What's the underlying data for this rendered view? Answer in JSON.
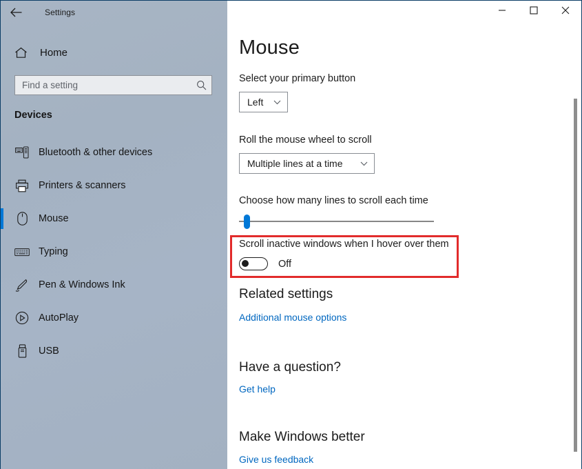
{
  "window": {
    "app_title": "Settings",
    "back_icon": "back-arrow-icon",
    "controls": {
      "minimize": "minimize-icon",
      "maximize": "maximize-icon",
      "close": "close-icon"
    }
  },
  "sidebar": {
    "home_label": "Home",
    "home_icon": "home-icon",
    "search": {
      "value": "",
      "placeholder": "Find a setting",
      "icon": "search-icon"
    },
    "category_heading": "Devices",
    "items": [
      {
        "label": "Bluetooth & other devices",
        "icon": "bluetooth-devices-icon",
        "selected": false
      },
      {
        "label": "Printers & scanners",
        "icon": "printer-icon",
        "selected": false
      },
      {
        "label": "Mouse",
        "icon": "mouse-icon",
        "selected": true
      },
      {
        "label": "Typing",
        "icon": "keyboard-icon",
        "selected": false
      },
      {
        "label": "Pen & Windows Ink",
        "icon": "pen-icon",
        "selected": false
      },
      {
        "label": "AutoPlay",
        "icon": "autoplay-icon",
        "selected": false
      },
      {
        "label": "USB",
        "icon": "usb-icon",
        "selected": false
      }
    ]
  },
  "main": {
    "page_title": "Mouse",
    "primary_button": {
      "label": "Select your primary button",
      "value": "Left",
      "chevron": "chevron-down-icon"
    },
    "scroll_wheel": {
      "label": "Roll the mouse wheel to scroll",
      "value": "Multiple lines at a time",
      "chevron": "chevron-down-icon"
    },
    "lines_slider": {
      "label": "Choose how many lines to scroll each time",
      "value": 3,
      "min": 1,
      "max": 100
    },
    "inactive_scroll": {
      "label": "Scroll inactive windows when I hover over them",
      "state": "Off",
      "checked": false,
      "highlighted": true
    },
    "related_settings": {
      "heading": "Related settings",
      "link": "Additional mouse options"
    },
    "question": {
      "heading": "Have a question?",
      "link": "Get help"
    },
    "feedback": {
      "heading": "Make Windows better",
      "link": "Give us feedback"
    }
  },
  "colors": {
    "accent": "#0078d7",
    "highlight": "#e22b2b",
    "link": "#0067c0",
    "sidebar": "#a4b2c2"
  }
}
